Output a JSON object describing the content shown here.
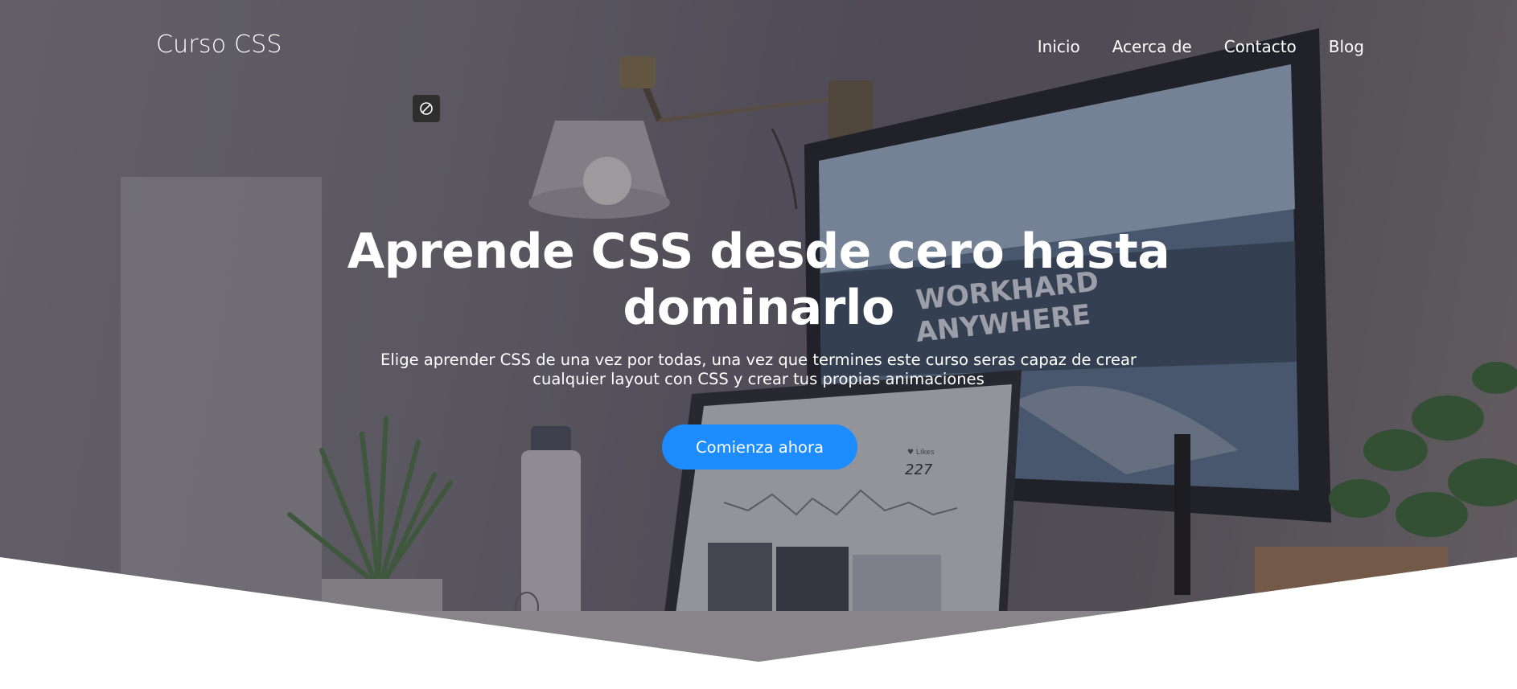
{
  "brand": {
    "name": "Curso CSS"
  },
  "nav": {
    "items": [
      {
        "label": "Inicio"
      },
      {
        "label": "Acerca de"
      },
      {
        "label": "Contacto"
      },
      {
        "label": "Blog"
      }
    ]
  },
  "hero": {
    "title": "Aprende CSS desde cero hasta dominarlo",
    "subtitle": "Elige aprender CSS de una vez por todas, una vez que termines este curso seras capaz de crear cualquier layout con CSS y crear tus propias animaciones",
    "cta_label": "Comienza ahora",
    "background_image": {
      "monitor_wallpaper_line1": "WORKHARD",
      "monitor_wallpaper_line2": "ANYWHERE",
      "laptop_stat_value": "227",
      "laptop_stat_label": "♥ Likes"
    }
  },
  "floating_icon": {
    "icon": "block-icon"
  },
  "colors": {
    "accent": "#1c8cff",
    "text": "#ffffff",
    "overlay": "#2a2535",
    "page_bg": "#ffffff"
  }
}
